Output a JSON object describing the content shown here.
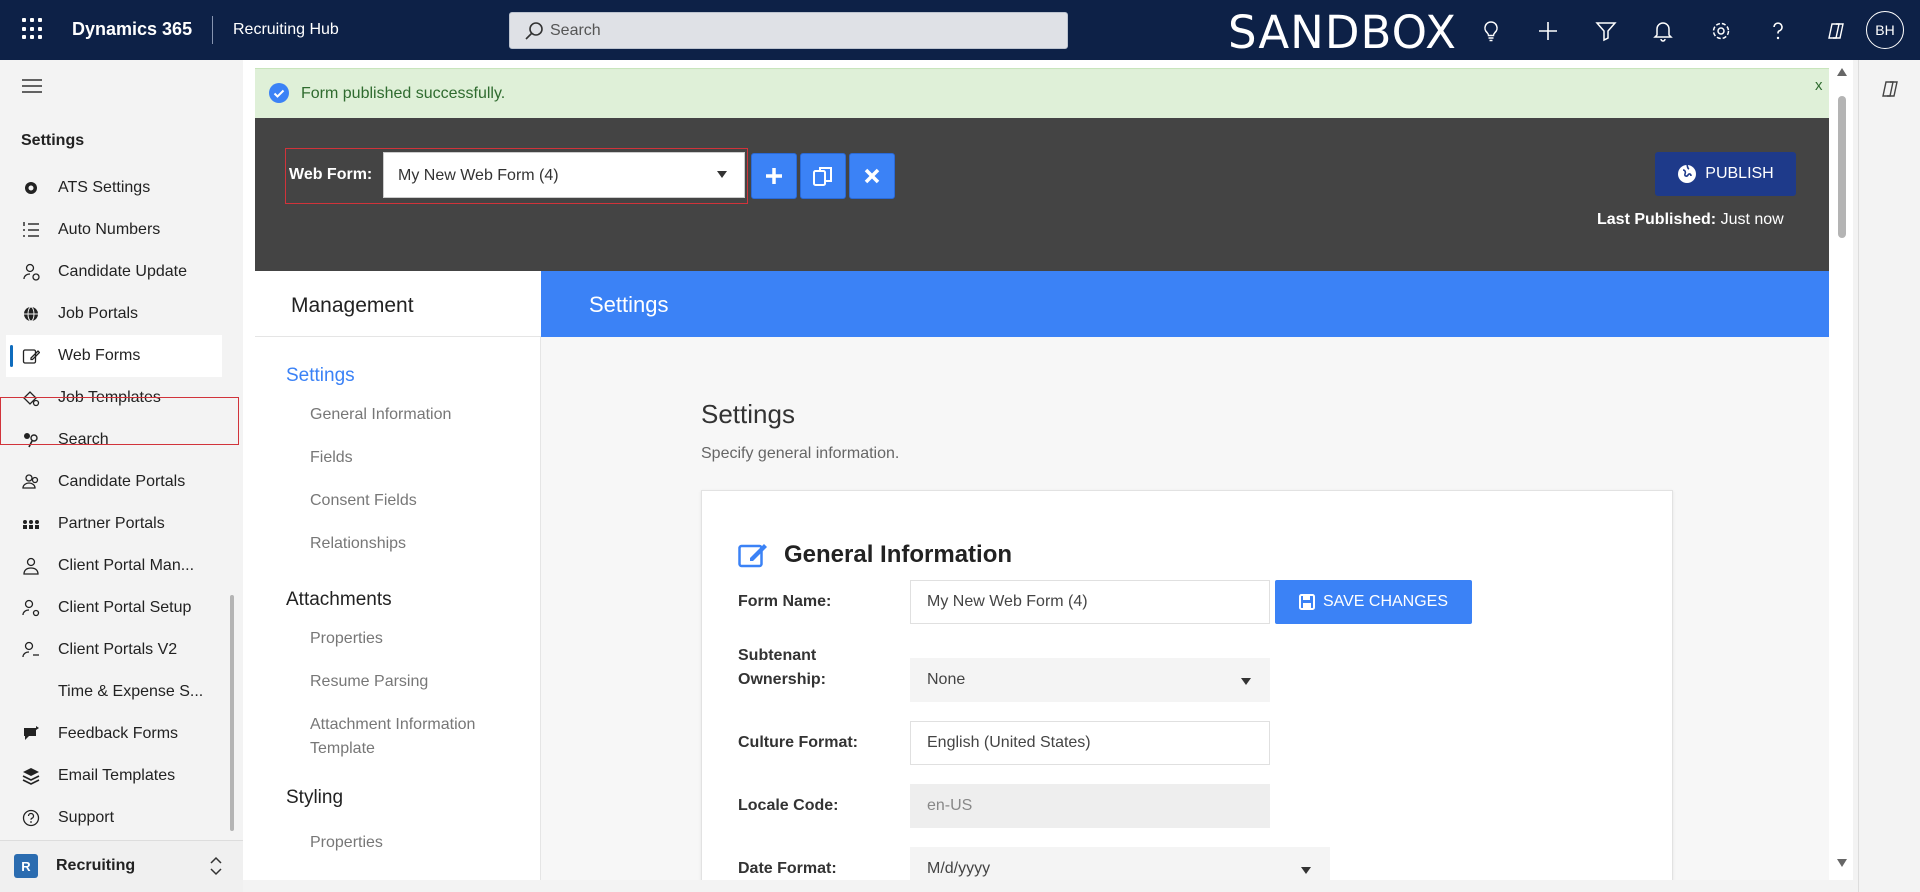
{
  "topbar": {
    "brand": "Dynamics 365",
    "app_name": "Recruiting Hub",
    "search_placeholder": "Search",
    "environment_label": "SANDBOX",
    "avatar_initials": "BH",
    "icons": [
      "lightbulb-icon",
      "plus-icon",
      "filter-icon",
      "bell-icon",
      "gear-icon",
      "help-icon",
      "copilot-icon"
    ]
  },
  "sidebar": {
    "title": "Settings",
    "items": [
      {
        "label": "ATS Settings",
        "icon": "gear-icon"
      },
      {
        "label": "Auto Numbers",
        "icon": "numbered-list-icon"
      },
      {
        "label": "Candidate Update",
        "icon": "person-sync-icon"
      },
      {
        "label": "Job Portals",
        "icon": "globe-icon"
      },
      {
        "label": "Web Forms",
        "icon": "form-edit-icon"
      },
      {
        "label": "Job Templates",
        "icon": "template-icon"
      },
      {
        "label": "Search",
        "icon": "search-people-icon"
      },
      {
        "label": "Candidate Portals",
        "icon": "people-icon"
      },
      {
        "label": "Partner Portals",
        "icon": "group-icon"
      },
      {
        "label": "Client Portal Man...",
        "icon": "person-building-icon"
      },
      {
        "label": "Client Portal Setup",
        "icon": "person-settings-icon"
      },
      {
        "label": "Client Portals V2",
        "icon": "person-key-icon"
      },
      {
        "label": "Time & Expense S...",
        "icon": ""
      },
      {
        "label": "Feedback Forms",
        "icon": "feedback-icon"
      },
      {
        "label": "Email Templates",
        "icon": "layers-icon"
      },
      {
        "label": "Support",
        "icon": "question-circle-icon"
      }
    ],
    "area_badge": "R",
    "area_label": "Recruiting"
  },
  "alert": {
    "message": "Form published successfully.",
    "close": "x"
  },
  "toolbar": {
    "web_form_label": "Web Form:",
    "web_form_value": "My New Web Form (4)",
    "publish_label": "PUBLISH",
    "last_published_label": "Last Published:",
    "last_published_value": "Just now"
  },
  "management": {
    "header": "Management",
    "panel_header": "Settings",
    "sections": [
      {
        "label": "Settings",
        "items": [
          "General Information",
          "Fields",
          "Consent Fields",
          "Relationships"
        ]
      },
      {
        "label": "Attachments",
        "items": [
          "Properties",
          "Resume Parsing",
          "Attachment Information Template"
        ]
      },
      {
        "label": "Styling",
        "items": [
          "Properties"
        ]
      }
    ]
  },
  "main": {
    "title": "Settings",
    "subtitle": "Specify general information.",
    "card_title": "General Information",
    "save_label": "SAVE CHANGES",
    "fields": {
      "form_name_label": "Form Name:",
      "form_name_value": "My New Web Form (4)",
      "subtenant_label": "Subtenant Ownership:",
      "subtenant_value": "None",
      "culture_label": "Culture Format:",
      "culture_value": "English (United States)",
      "locale_label": "Locale Code:",
      "locale_value": "en-US",
      "date_label": "Date Format:",
      "date_value": "M/d/yyyy"
    }
  },
  "colors": {
    "topbar": "#0d2147",
    "accent": "#3b82f6",
    "publish": "#1e3a8a",
    "toolbar_bg": "#444444",
    "alert_bg": "#dff0d8",
    "highlight": "#d1333a"
  }
}
